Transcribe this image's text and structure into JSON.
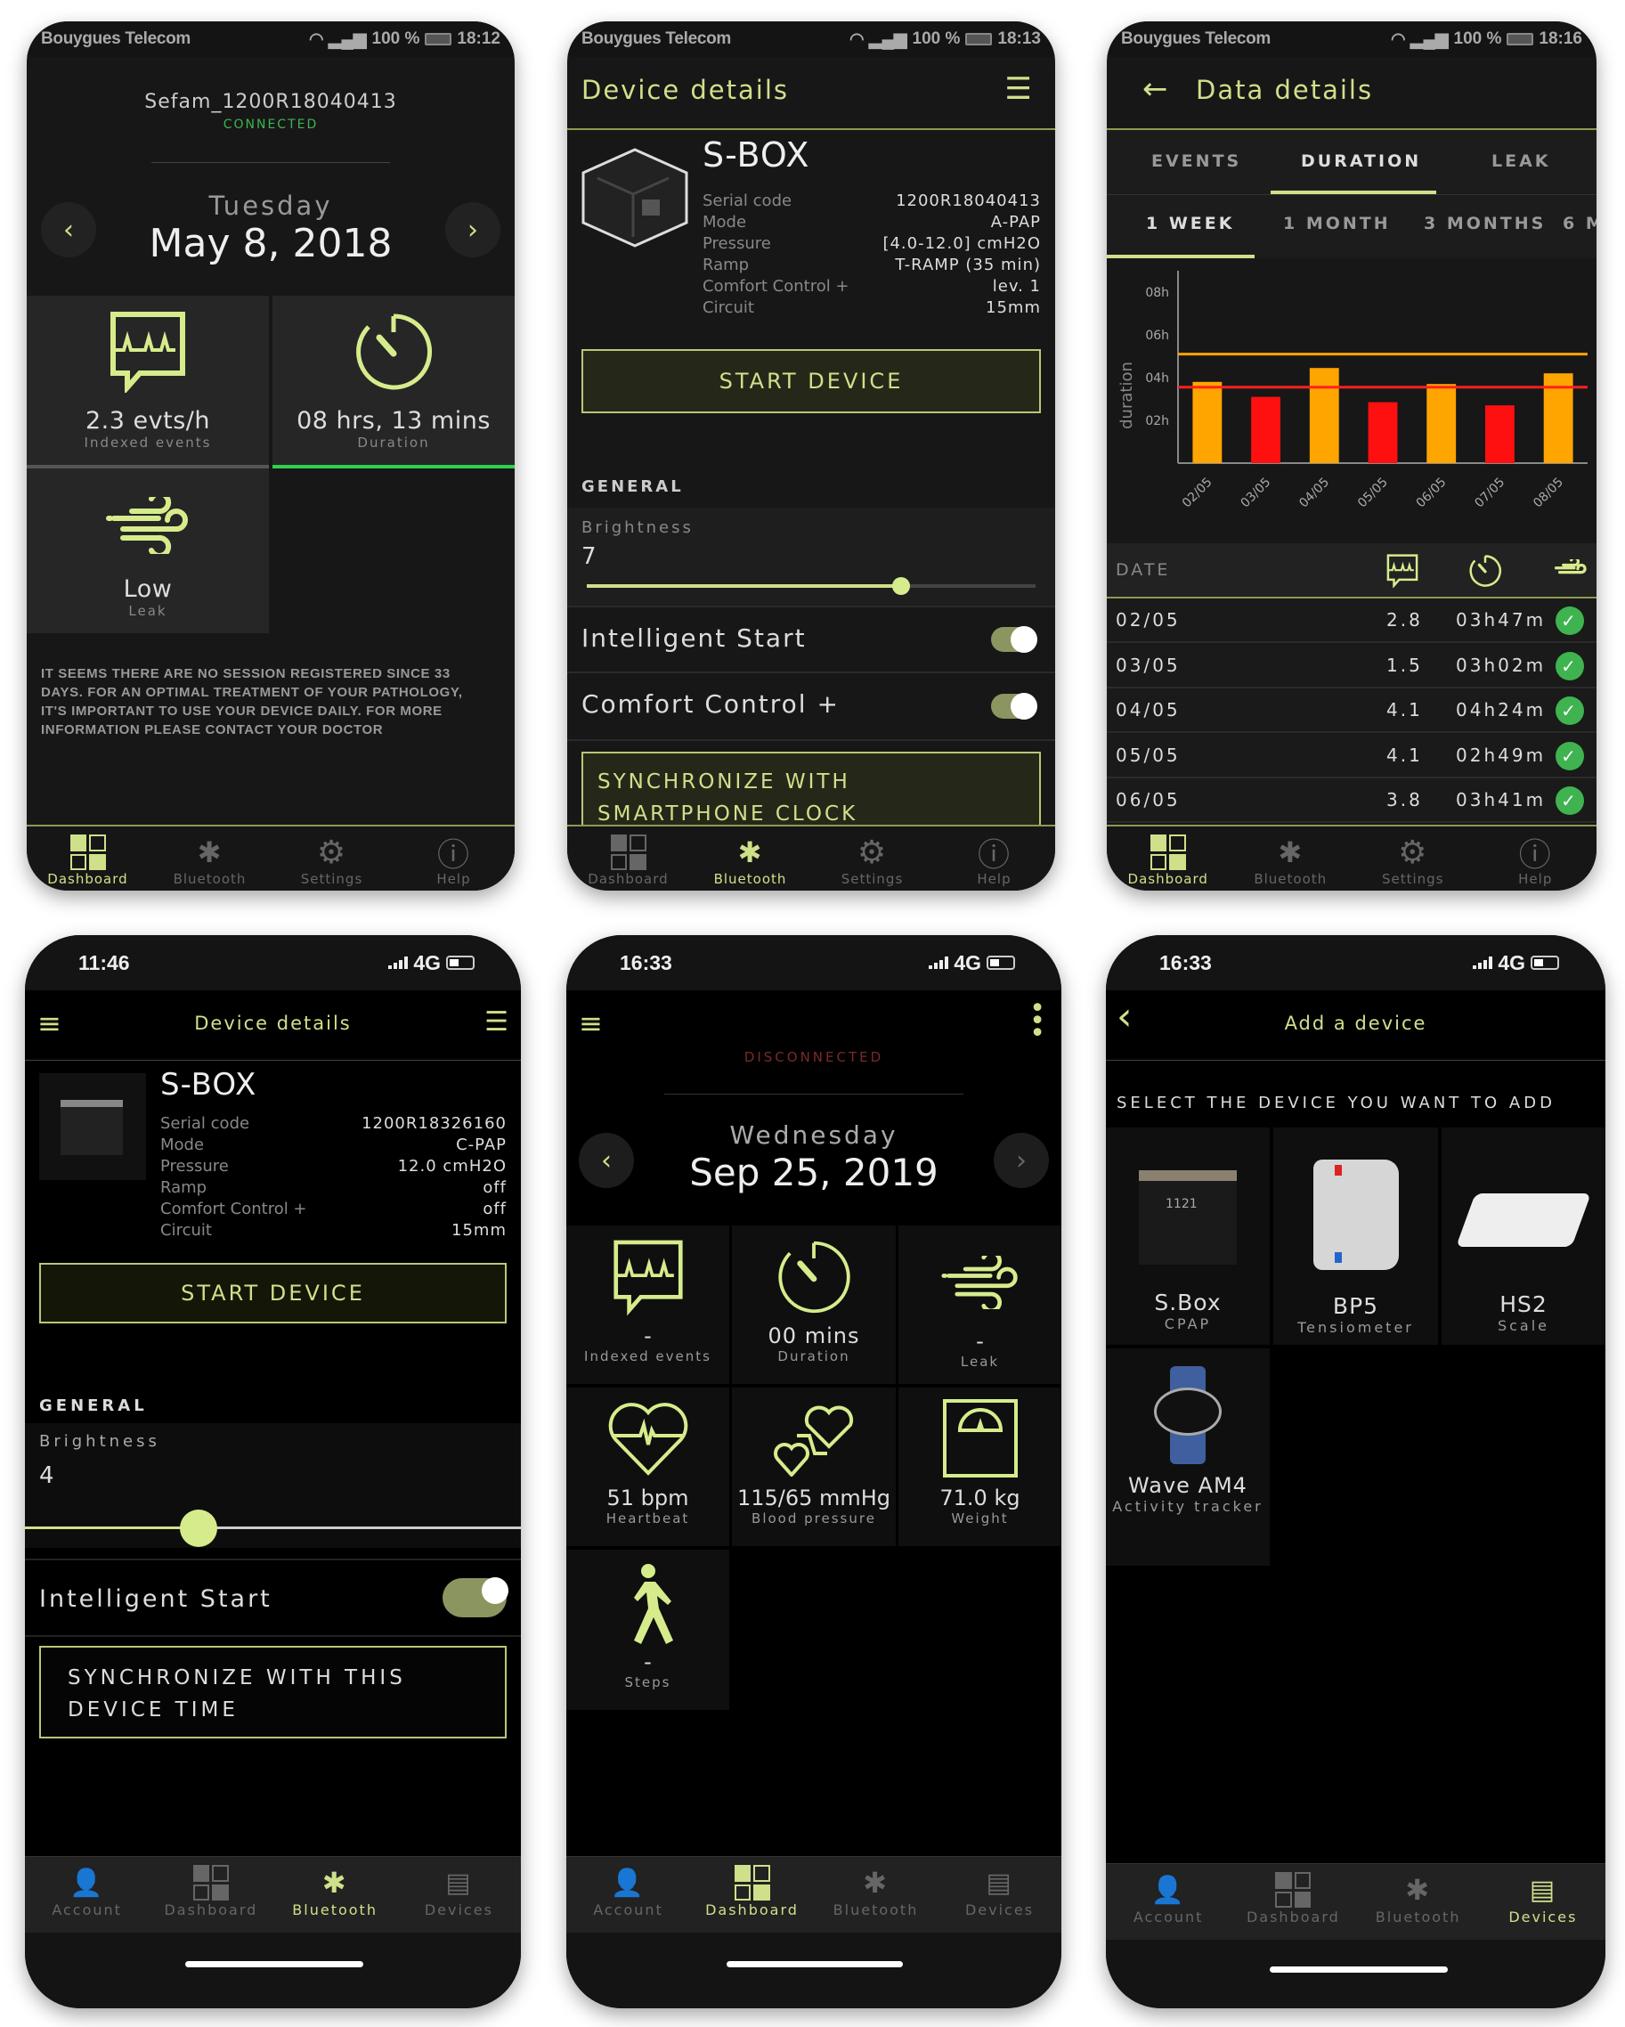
{
  "colors": {
    "accent": "#cfe08a",
    "connected": "#3fb34f",
    "disconnected": "#7a2a2a",
    "bar_orange": "#ffa500",
    "bar_red": "#ff1010",
    "line_orange": "#ffa500",
    "line_red": "#ff2020",
    "check_green": "#3fb34f"
  },
  "android_nav": [
    {
      "label": "Dashboard",
      "icon": "dashboard-grid-icon"
    },
    {
      "label": "Bluetooth",
      "icon": "bluetooth-icon"
    },
    {
      "label": "Settings",
      "icon": "gear-icon"
    },
    {
      "label": "Help",
      "icon": "info-icon"
    }
  ],
  "ios_nav": [
    {
      "label": "Account",
      "icon": "account-icon"
    },
    {
      "label": "Dashboard",
      "icon": "dashboard-grid-icon"
    },
    {
      "label": "Bluetooth",
      "icon": "bluetooth-icon"
    },
    {
      "label": "Devices",
      "icon": "devices-chip-icon"
    }
  ],
  "screen1": {
    "status": {
      "carrier": "Bouygues Telecom",
      "battery": "100 %",
      "time": "18:12"
    },
    "device_name": "Sefam_1200R18040413",
    "connection": "CONNECTED",
    "day": "Tuesday",
    "date": "May 8, 2018",
    "tiles": [
      {
        "value": "2.3 evts/h",
        "label": "Indexed events",
        "icon": "events-monitor-icon"
      },
      {
        "value": "08 hrs, 13 mins",
        "label": "Duration",
        "icon": "timer-icon"
      },
      {
        "value": "Low",
        "label": "Leak",
        "icon": "wind-leak-icon"
      }
    ],
    "message": "IT SEEMS THERE ARE NO SESSION REGISTERED SINCE 33 DAYS. FOR AN OPTIMAL TREATMENT OF YOUR PATHOLOGY, IT'S IMPORTANT TO USE YOUR DEVICE DAILY. FOR MORE INFORMATION PLEASE CONTACT YOUR DOCTOR",
    "active_nav": "Dashboard"
  },
  "screen2": {
    "status": {
      "carrier": "Bouygues Telecom",
      "battery": "100 %",
      "time": "18:13"
    },
    "title": "Device details",
    "device": {
      "name": "S-BOX",
      "specs": [
        {
          "k": "Serial code",
          "v": "1200R18040413"
        },
        {
          "k": "Mode",
          "v": "A-PAP"
        },
        {
          "k": "Pressure",
          "v": "[4.0-12.0] cmH2O"
        },
        {
          "k": "Ramp",
          "v": "T-RAMP (35 min)"
        },
        {
          "k": "Comfort Control +",
          "v": "lev. 1"
        },
        {
          "k": "Circuit",
          "v": "15mm"
        }
      ]
    },
    "start_button": "START DEVICE",
    "section": "GENERAL",
    "brightness_label": "Brightness",
    "brightness_value": "7",
    "brightness_fraction": 0.7,
    "toggles": [
      {
        "label": "Intelligent Start",
        "on": true
      },
      {
        "label": "Comfort Control +",
        "on": true
      }
    ],
    "sync_button": "SYNCHRONIZE WITH SMARTPHONE CLOCK",
    "active_nav": "Bluetooth"
  },
  "screen3": {
    "status": {
      "carrier": "Bouygues Telecom",
      "battery": "100 %",
      "time": "18:16"
    },
    "title": "Data details",
    "tabs": [
      "EVENTS",
      "DURATION",
      "LEAK"
    ],
    "active_tab": "DURATION",
    "periods": [
      "1 WEEK",
      "1 MONTH",
      "3 MONTHS",
      "6 M"
    ],
    "active_period": "1 WEEK",
    "table": {
      "header": {
        "date": "DATE",
        "icons": [
          "events-monitor-icon",
          "timer-icon",
          "wind-leak-icon"
        ]
      },
      "rows": [
        {
          "date": "02/05",
          "events": "2.8",
          "duration": "03h47m",
          "ok": true
        },
        {
          "date": "03/05",
          "events": "1.5",
          "duration": "03h02m",
          "ok": true
        },
        {
          "date": "04/05",
          "events": "4.1",
          "duration": "04h24m",
          "ok": true
        },
        {
          "date": "05/05",
          "events": "4.1",
          "duration": "02h49m",
          "ok": true
        },
        {
          "date": "06/05",
          "events": "3.8",
          "duration": "03h41m",
          "ok": true
        }
      ]
    },
    "active_nav": "Dashboard"
  },
  "chart_data": {
    "type": "bar",
    "title": "",
    "xlabel": "",
    "ylabel": "duration",
    "categories": [
      "02/05",
      "03/05",
      "04/05",
      "05/05",
      "06/05",
      "07/05",
      "08/05"
    ],
    "values": [
      3.8,
      3.1,
      4.45,
      2.85,
      3.7,
      2.7,
      4.2
    ],
    "bar_colors": [
      "orange",
      "red",
      "orange",
      "red",
      "orange",
      "red",
      "orange"
    ],
    "yticks": [
      {
        "v": 2,
        "label": "02h"
      },
      {
        "v": 4,
        "label": "04h"
      },
      {
        "v": 6,
        "label": "06h"
      },
      {
        "v": 8,
        "label": "08h"
      }
    ],
    "ylim": [
      0,
      9
    ],
    "reference_lines": [
      {
        "value": 5.1,
        "color": "orange"
      },
      {
        "value": 3.55,
        "color": "red"
      }
    ],
    "grid": false,
    "legend": "none"
  },
  "screen4": {
    "status": {
      "time": "11:46",
      "network": "4G"
    },
    "title": "Device details",
    "device": {
      "name": "S-BOX",
      "specs": [
        {
          "k": "Serial code",
          "v": "1200R18326160"
        },
        {
          "k": "Mode",
          "v": "C-PAP"
        },
        {
          "k": "Pressure",
          "v": "12.0 cmH2O"
        },
        {
          "k": "Ramp",
          "v": "off"
        },
        {
          "k": "Comfort Control +",
          "v": "off"
        },
        {
          "k": "Circuit",
          "v": "15mm"
        }
      ]
    },
    "start_button": "START DEVICE",
    "section": "GENERAL",
    "brightness_label": "Brightness",
    "brightness_value": "4",
    "brightness_fraction": 0.35,
    "toggles": [
      {
        "label": "Intelligent Start",
        "on": true
      }
    ],
    "sync_button": "SYNCHRONIZE WITH THIS DEVICE TIME",
    "active_nav": "Bluetooth"
  },
  "screen5": {
    "status": {
      "time": "16:33",
      "network": "4G"
    },
    "connection": "DISCONNECTED",
    "day": "Wednesday",
    "date": "Sep 25, 2019",
    "tiles": [
      {
        "value": "-",
        "label": "Indexed events",
        "icon": "events-monitor-icon"
      },
      {
        "value": "00 mins",
        "label": "Duration",
        "icon": "timer-icon"
      },
      {
        "value": "-",
        "label": "Leak",
        "icon": "wind-leak-icon"
      },
      {
        "value": "51 bpm",
        "label": "Heartbeat",
        "icon": "heartbeat-icon"
      },
      {
        "value": "115/65 mmHg",
        "label": "Blood pressure",
        "icon": "blood-pressure-icon"
      },
      {
        "value": "71.0 kg",
        "label": "Weight",
        "icon": "scale-icon"
      },
      {
        "value": "-",
        "label": "Steps",
        "icon": "walking-icon"
      }
    ],
    "active_nav": "Dashboard"
  },
  "screen6": {
    "status": {
      "time": "16:33",
      "network": "4G"
    },
    "title": "Add a device",
    "instruction": "SELECT THE DEVICE YOU WANT TO ADD",
    "devices": [
      {
        "name": "S.Box",
        "type": "CPAP"
      },
      {
        "name": "BP5",
        "type": "Tensiometer"
      },
      {
        "name": "HS2",
        "type": "Scale"
      },
      {
        "name": "Wave AM4",
        "type": "Activity tracker"
      }
    ],
    "active_nav": "Devices"
  }
}
